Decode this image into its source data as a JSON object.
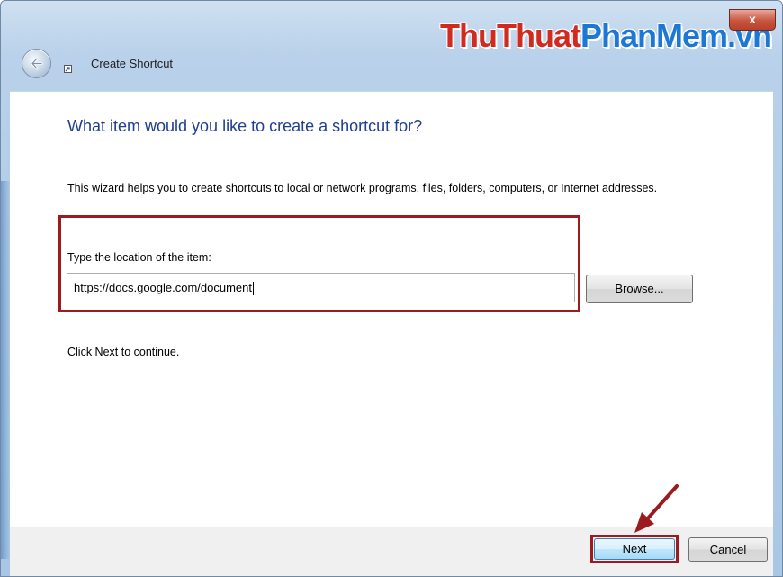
{
  "window": {
    "title": "Create Shortcut",
    "close_label": "x"
  },
  "watermark": {
    "part1": "ThuThuat",
    "part2": "PhanMem.vn"
  },
  "wizard": {
    "heading": "What item would you like to create a shortcut for?",
    "description": "This wizard helps you to create shortcuts to local or network programs, files, folders, computers, or Internet addresses.",
    "field_label": "Type the location of the item:",
    "location_value": "https://docs.google.com/document",
    "browse_label": "Browse...",
    "hint": "Click Next to continue."
  },
  "footer": {
    "next_label": "Next",
    "cancel_label": "Cancel"
  },
  "icons": {
    "back": "back-arrow-icon",
    "shortcut": "shortcut-icon",
    "close": "close-icon"
  },
  "colors": {
    "heading": "#1f3e8f",
    "highlight": "#9b1b1f",
    "close_button": "#c8553e",
    "watermark_red": "#d12a1f",
    "watermark_blue": "#1d77d4"
  }
}
